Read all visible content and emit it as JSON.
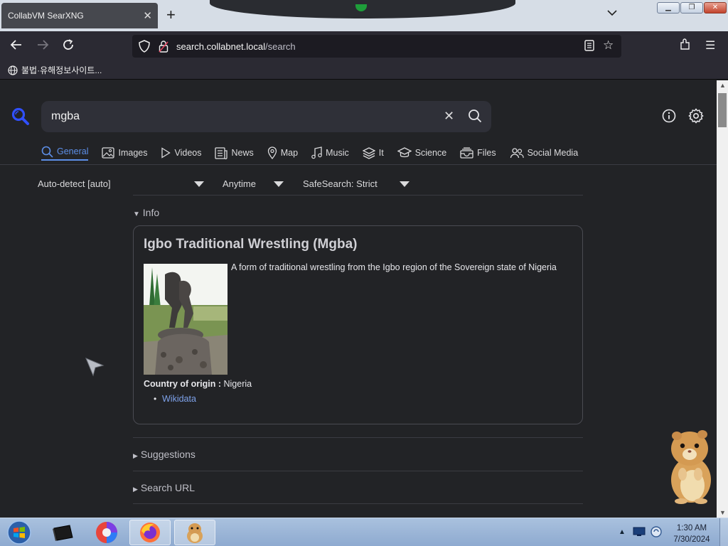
{
  "browser": {
    "tab_title": "CollabVM SearXNG",
    "url_host": "search.collabnet.local",
    "url_path": "/search",
    "bookmark_label": "불법·유해정보사이트..."
  },
  "search": {
    "query": "mgba"
  },
  "categories": [
    {
      "label": "General",
      "icon": "search-icon"
    },
    {
      "label": "Images",
      "icon": "image-icon"
    },
    {
      "label": "Videos",
      "icon": "play-icon"
    },
    {
      "label": "News",
      "icon": "newspaper-icon"
    },
    {
      "label": "Map",
      "icon": "map-pin-icon"
    },
    {
      "label": "Music",
      "icon": "music-icon"
    },
    {
      "label": "It",
      "icon": "layers-icon"
    },
    {
      "label": "Science",
      "icon": "school-icon"
    },
    {
      "label": "Files",
      "icon": "file-tray-icon"
    },
    {
      "label": "Social Media",
      "icon": "people-icon"
    }
  ],
  "filters": {
    "language": "Auto-detect [auto]",
    "time": "Anytime",
    "safesearch": "SafeSearch: Strict"
  },
  "infobox": {
    "section": "Info",
    "title": "Igbo Traditional Wrestling (Mgba)",
    "description": "A form of traditional wrestling from the Igbo region of the Sovereign state of Nigeria",
    "attr_label": "Country of origin :",
    "attr_value": "Nigeria",
    "link": "Wikidata"
  },
  "sections": {
    "suggestions": "Suggestions",
    "search_url": "Search URL"
  },
  "taskbar": {
    "time": "1:30 AM",
    "date": "7/30/2024"
  },
  "colors": {
    "accent": "#5d8fe8",
    "page_bg": "#222326",
    "link": "#7ea2ea"
  }
}
